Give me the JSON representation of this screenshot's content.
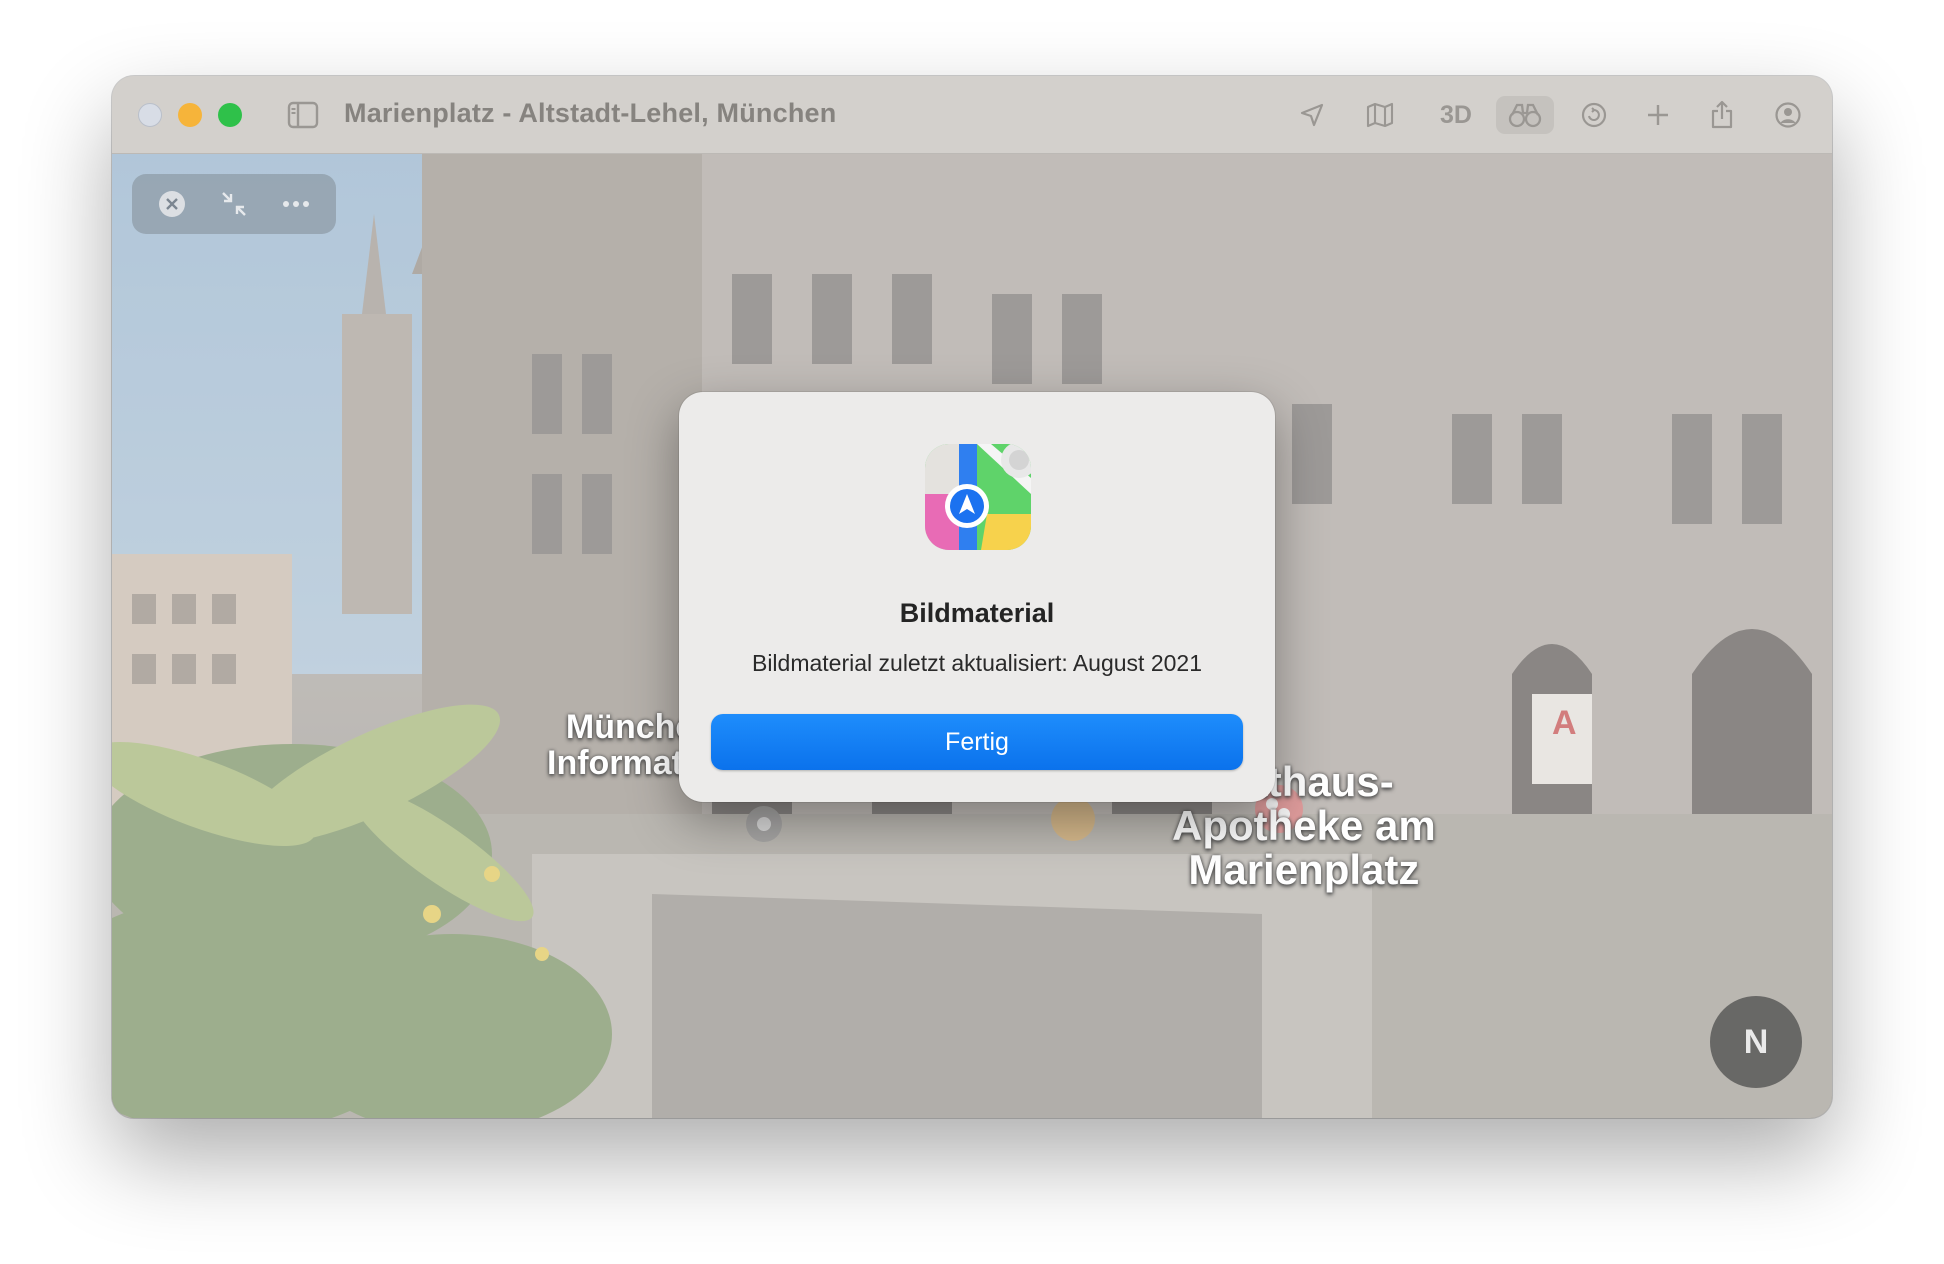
{
  "window": {
    "title": "Marienplatz - Altstadt-Lehel, München"
  },
  "toolbar": {
    "icons": [
      "location-arrow-icon",
      "map-icon",
      "3d",
      "binoculars-icon",
      "rotate-icon",
      "add-icon",
      "share-icon",
      "account-icon"
    ],
    "three_d_label": "3D"
  },
  "look_around": {
    "controls": [
      "close-icon",
      "collapse-icon",
      "more-icon"
    ],
    "poi_labels": [
      {
        "text": "München\nInformation"
      },
      {
        "text": "Rathaus-\nApotheke am\nMarienplatz"
      }
    ],
    "compass_label": "N"
  },
  "dialog": {
    "title": "Bildmaterial",
    "message": "Bildmaterial zuletzt aktualisiert: August 2021",
    "button_label": "Fertig",
    "button_color": "#0b72ec"
  }
}
